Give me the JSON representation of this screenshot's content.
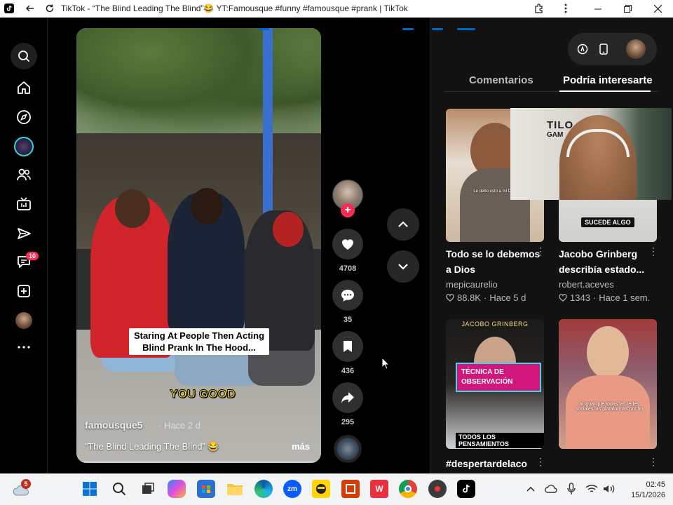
{
  "browser": {
    "title": "TikTok - “The Blind Leading The Blind”😂 YT:Famousque #funny #famousque #prank | TikTok",
    "tab_icon": "tiktok-icon"
  },
  "rail": {
    "items": [
      "search-icon",
      "home-icon",
      "explore-icon",
      "live-avatar",
      "friends-icon",
      "live-tv-icon",
      "following-icon",
      "messages-icon",
      "upload-icon",
      "profile-avatar",
      "more-icon"
    ],
    "messages_badge": "10"
  },
  "video": {
    "caption_overlay": "Staring At People Then Acting Blind Prank In The Hood...",
    "subtitle_overlay": "YOU GOOD",
    "author": "famousque5",
    "date": "· Hace 2 d",
    "description": "“The Blind Leading The Blind” 😂",
    "more_label": "más"
  },
  "actions": {
    "likes": "4708",
    "comments": "35",
    "saves": "436",
    "shares": "295"
  },
  "panel": {
    "tabs": [
      "Comentarios",
      "Podría interesarte"
    ],
    "active_tab": 1,
    "videos": [
      {
        "title": "Todo se lo debemos a Dios",
        "author": "mepicaurelio",
        "likes": "88.8K",
        "age": "Hace 5 d",
        "overlay": "Le debo esto a mi Dios"
      },
      {
        "title": "Jacobo Grinberg describía estado...",
        "author": "robert.aceves",
        "likes": "1343",
        "age": "Hace 1 sem.",
        "overlay": "SUCEDE ALGO"
      },
      {
        "title": "#despertardelaco",
        "top_text": "JACOBO GRINBERG",
        "overlay": "TÉCNICA DE OBSERVACIÓN",
        "bottom_text": "TODOS LOS PENSAMIENTOS"
      },
      {
        "title": "",
        "overlay": "al igual que todas las redes sociales las plataformas por fin"
      }
    ],
    "webcam_sign_1": "TILO",
    "webcam_sign_2": "GAM"
  },
  "taskbar": {
    "weather_badge": "5",
    "time": "02:45",
    "date": "15/1/2026",
    "apps": [
      "windows-start-icon",
      "search-icon",
      "task-view-icon",
      "copilot-icon",
      "store-icon",
      "file-explorer-icon",
      "edge-icon",
      "zoom-icon",
      "app-avatar-icon",
      "office-icon",
      "wps-icon",
      "chrome-icon",
      "camera-app-icon",
      "tiktok-icon"
    ]
  },
  "colors": {
    "accent": "#fe2c55",
    "panel_bg": "#121212",
    "rail_bg": "#000000"
  }
}
